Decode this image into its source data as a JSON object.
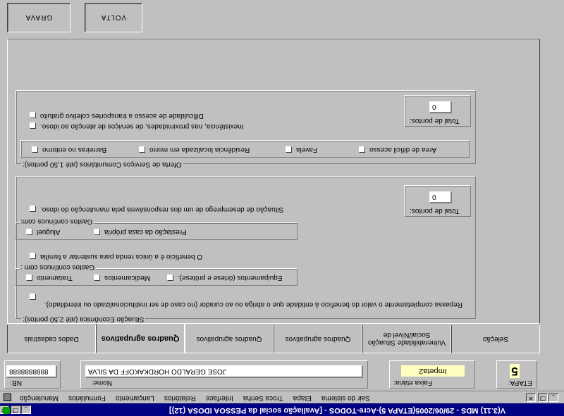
{
  "window": {
    "title": "V(3.11) MDS - 29/06/2005(ETAPA 5)-Acre-TODOS - [Avaliação social da PESSOA IDOSA (12)]",
    "controls": [
      "_",
      "❐",
      "✕"
    ]
  },
  "menu": {
    "items": [
      "Manutenção",
      "Formulários",
      "Lançamento",
      "Relatórios",
      "Interface",
      "Troca Senha",
      "Etapa",
      "Sair do sistema"
    ]
  },
  "toolbar": {
    "grava_label": "GRAVA",
    "volta_label": "VOLTA"
  },
  "tabs": [
    {
      "label": "Dados cadastrais"
    },
    {
      "label": "Quadros agrupativos"
    },
    {
      "label": "Quadros agrupativos"
    },
    {
      "label": "Quadros agrupativos"
    },
    {
      "label": "Vulnerabilidade Situação Social/Nível de"
    },
    {
      "label": "Seleção"
    }
  ],
  "situacao_economica": {
    "legend": "Situação Econômica (até 2,50 pontos):",
    "repassa_label": "Repassa completamente o valor do benefício à entidade que o abriga ou ao curador (no caso de ser institucionalizado ou interditado).",
    "gastos_com_label": "Gastos contínuos com :",
    "gastos_items": [
      "Tratamento",
      "Medicamentos",
      "Equipamentos (órtese e prótese)."
    ],
    "unica_renda_label": "O benefício é a única renda para sustentar a família",
    "gastos_com2_label": "Gastos contínuos com:",
    "gastos2_items": [
      "Aluguel",
      "Prestação da casa própria"
    ],
    "desemprego_label": "Situação de desemprego de um dos responsáveis pela manutenção do idoso.",
    "total_label": "Total de pontos:",
    "total_value": "0"
  },
  "servicos_comunitarios": {
    "legend": "Oferta de Serviços Comunitários (até 1,50 pontos):",
    "local_items": [
      "Barreiras no entorno",
      "Residência localizada em morro",
      "Favela",
      "Área de difícil acesso"
    ],
    "inexistencia_label": "Inexistência, nas proximidades, de serviços de atenção ao idoso.",
    "dificuldade_label": "Dificuldade de acesso a transportes coletivo gratuito",
    "total_label": "Total de pontos:",
    "total_value": "0"
  },
  "status_row": {
    "nb_label": "NB:",
    "nb_value": "8888888888",
    "nome_label": "Nome:",
    "nome_value": "JOSE GERALDO HORDKAKOFF DA SILVA",
    "faixa_label": "Faixa etária:",
    "faixa_value": "Impeta2",
    "etapa_label": "ETAPA:",
    "etapa_value": "5"
  },
  "colors": {
    "face": "#c0c0c0",
    "title_bar": "#000080",
    "faixa_bg": "#ffffc0",
    "etapa_bg": "#ffffc0"
  },
  "icons": [
    "app-icon",
    "mdi-app-icon"
  ]
}
